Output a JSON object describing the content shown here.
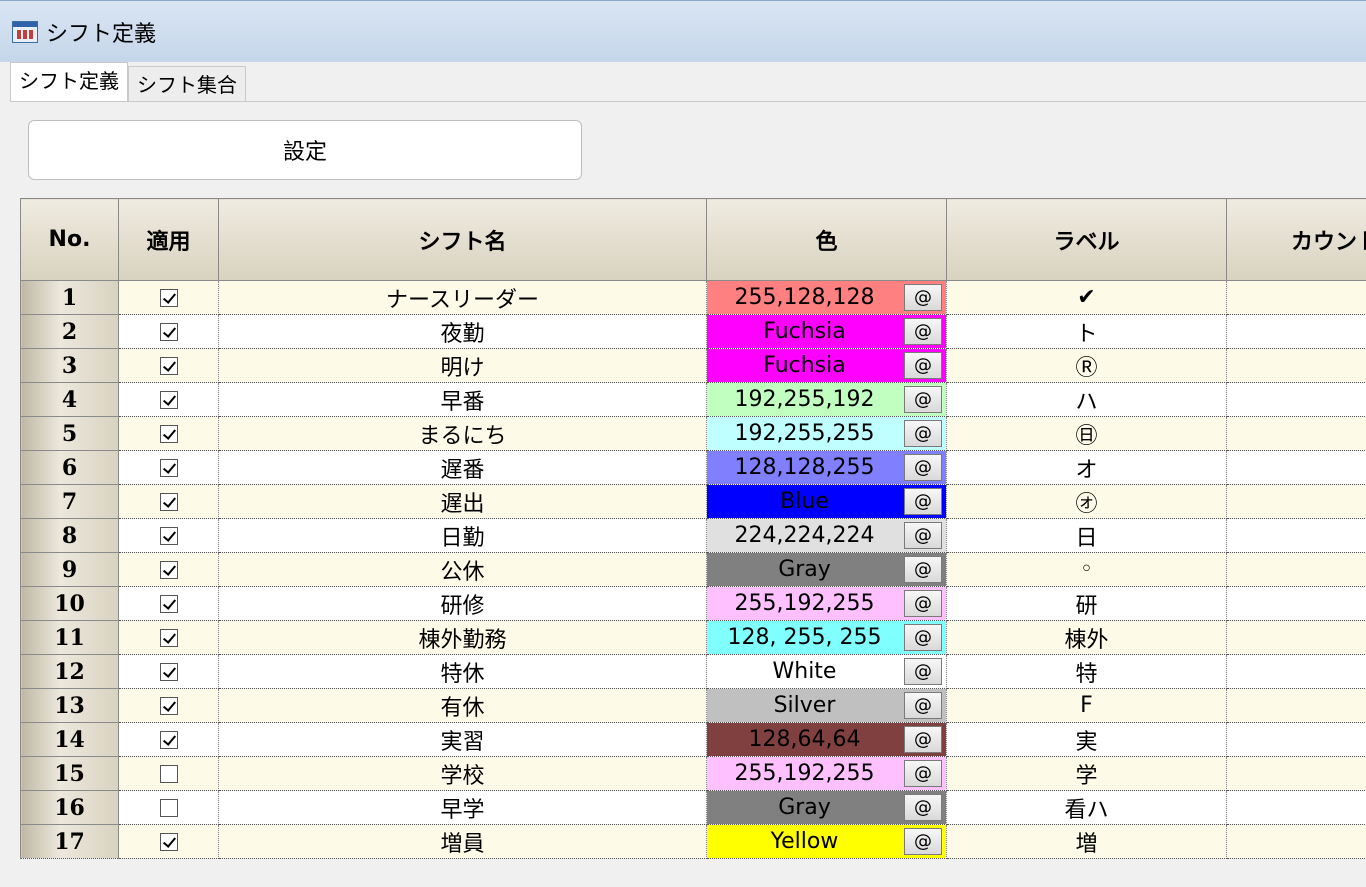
{
  "window": {
    "title": "シフト定義",
    "icon": "window-app-icon"
  },
  "tabs": [
    {
      "label": "シフト定義",
      "active": true
    },
    {
      "label": "シフト集合",
      "active": false
    }
  ],
  "settings_button": "設定",
  "table": {
    "headers": {
      "no": "No.",
      "apply": "適用",
      "name": "シフト名",
      "color": "色",
      "label": "ラベル",
      "count": "カウント"
    },
    "at_label": "@",
    "rows": [
      {
        "no": "1",
        "apply": true,
        "name": "ナースリーダー",
        "color": "255,128,128",
        "bg": "#ff8080",
        "fg": "#000000",
        "label": "✔"
      },
      {
        "no": "2",
        "apply": true,
        "name": "夜勤",
        "color": "Fuchsia",
        "bg": "#ff00ff",
        "fg": "#000000",
        "label": "ト"
      },
      {
        "no": "3",
        "apply": true,
        "name": "明け",
        "color": "Fuchsia",
        "bg": "#ff00ff",
        "fg": "#000000",
        "label": "Ⓡ"
      },
      {
        "no": "4",
        "apply": true,
        "name": "早番",
        "color": "192,255,192",
        "bg": "#c0ffc0",
        "fg": "#000000",
        "label": "ハ"
      },
      {
        "no": "5",
        "apply": true,
        "name": "まるにち",
        "color": "192,255,255",
        "bg": "#c0ffff",
        "fg": "#000000",
        "label": "㊐"
      },
      {
        "no": "6",
        "apply": true,
        "name": "遅番",
        "color": "128,128,255",
        "bg": "#8080ff",
        "fg": "#000000",
        "label": "オ"
      },
      {
        "no": "7",
        "apply": true,
        "name": "遅出",
        "color": "Blue",
        "bg": "#0000ff",
        "fg": "#000000",
        "label": "㋔"
      },
      {
        "no": "8",
        "apply": true,
        "name": "日勤",
        "color": "224,224,224",
        "bg": "#e0e0e0",
        "fg": "#000000",
        "label": "日"
      },
      {
        "no": "9",
        "apply": true,
        "name": "公休",
        "color": "Gray",
        "bg": "#808080",
        "fg": "#000000",
        "label": "◦"
      },
      {
        "no": "10",
        "apply": true,
        "name": "研修",
        "color": "255,192,255",
        "bg": "#ffc0ff",
        "fg": "#000000",
        "label": "研"
      },
      {
        "no": "11",
        "apply": true,
        "name": "棟外勤務",
        "color": "128, 255, 255",
        "bg": "#80ffff",
        "fg": "#000000",
        "label": "棟外"
      },
      {
        "no": "12",
        "apply": true,
        "name": "特休",
        "color": "White",
        "bg": "#ffffff",
        "fg": "#000000",
        "label": "特"
      },
      {
        "no": "13",
        "apply": true,
        "name": "有休",
        "color": "Silver",
        "bg": "#c0c0c0",
        "fg": "#000000",
        "label": "F"
      },
      {
        "no": "14",
        "apply": true,
        "name": "実習",
        "color": "128,64,64",
        "bg": "#804040",
        "fg": "#000000",
        "label": "実"
      },
      {
        "no": "15",
        "apply": false,
        "name": "学校",
        "color": "255,192,255",
        "bg": "#ffc0ff",
        "fg": "#000000",
        "label": "学"
      },
      {
        "no": "16",
        "apply": false,
        "name": "早学",
        "color": "Gray",
        "bg": "#808080",
        "fg": "#000000",
        "label": "看ハ"
      },
      {
        "no": "17",
        "apply": true,
        "name": "増員",
        "color": "Yellow",
        "bg": "#ffff00",
        "fg": "#000000",
        "label": "増"
      }
    ]
  }
}
